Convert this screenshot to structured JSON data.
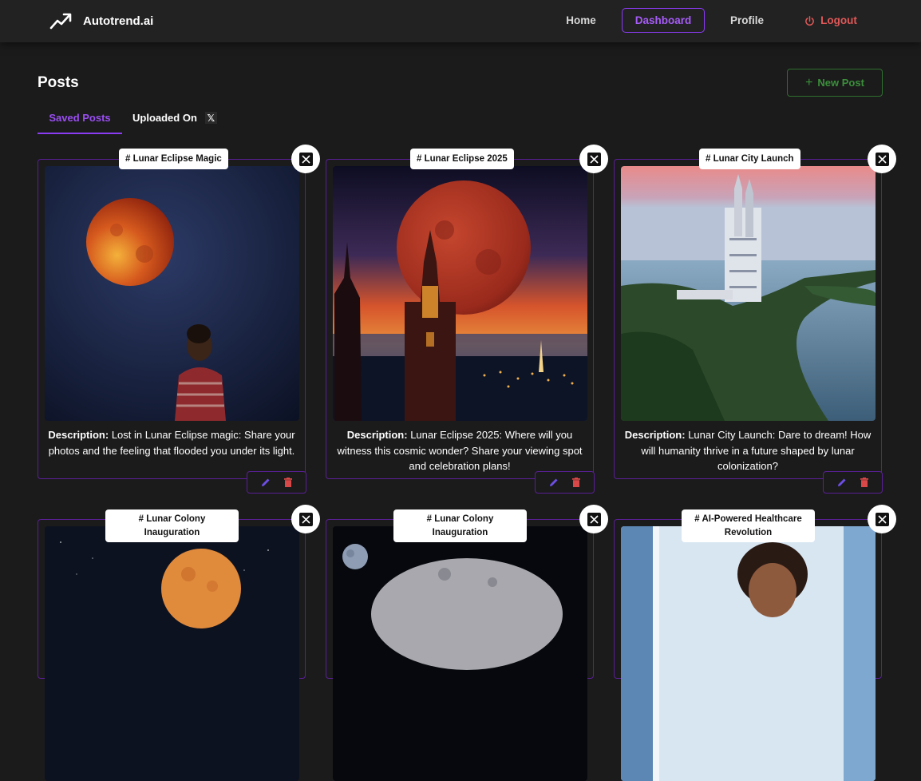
{
  "header": {
    "brand": "Autotrend.ai",
    "nav": {
      "home": "Home",
      "dashboard": "Dashboard",
      "profile": "Profile",
      "logout": "Logout"
    }
  },
  "page": {
    "title": "Posts",
    "new_post": "New Post",
    "tabs": {
      "saved": "Saved Posts",
      "uploaded": "Uploaded On",
      "uploaded_icon": "x-logo-icon"
    }
  },
  "colors": {
    "accent": "#8b3bf4",
    "logout": "#e25858",
    "new_post": "#3b8f3b",
    "delete": "#d84848"
  },
  "description_label": "Description:",
  "posts": [
    {
      "tag": "# Lunar Eclipse Magic",
      "description": "Lost in Lunar Eclipse magic: Share your photos and the feeling that flooded you under its light."
    },
    {
      "tag": "# Lunar Eclipse 2025",
      "description": "Lunar Eclipse 2025: Where will you witness this cosmic wonder? Share your viewing spot and celebration plans!"
    },
    {
      "tag": "# Lunar City Launch",
      "description": "Lunar City Launch: Dare to dream! How will humanity thrive in a future shaped by lunar colonization?"
    },
    {
      "tag": "# Lunar Colony Inauguration"
    },
    {
      "tag": "# Lunar Colony Inauguration"
    },
    {
      "tag": "# AI-Powered Healthcare Revolution"
    }
  ]
}
